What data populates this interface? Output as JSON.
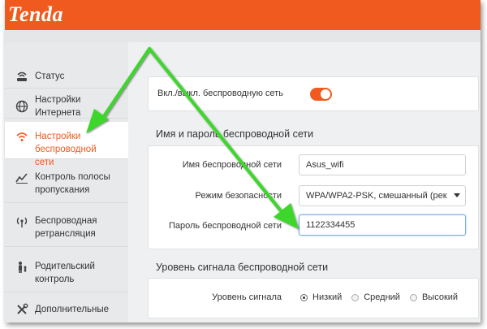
{
  "brand": {
    "logo": "Tenda",
    "accent": "#f05a1e"
  },
  "sidebar": {
    "items": [
      {
        "label": "Статус",
        "icon": "status-icon"
      },
      {
        "label": "Настройки Интернета",
        "icon": "globe-icon"
      },
      {
        "label": "Настройки беспроводной сети",
        "icon": "wifi-icon",
        "active": true
      },
      {
        "label": "Контроль полосы пропускания",
        "icon": "bandwidth-icon"
      },
      {
        "label": "Беспроводная ретрансляция",
        "icon": "repeater-icon"
      },
      {
        "label": "Родительский контроль",
        "icon": "parental-icon"
      },
      {
        "label": "Дополнительные",
        "icon": "tools-icon"
      }
    ]
  },
  "wireless_toggle": {
    "label": "Вкл./выкл. беспроводную сеть",
    "enabled": true
  },
  "ssid_section": {
    "title": "Имя и пароль беспроводной сети",
    "ssid_label": "Имя беспроводной сети",
    "ssid_value": "Asus_wifi",
    "security_label": "Режим безопасности",
    "security_value": "WPA/WPA2-PSK, смешанный (рек",
    "password_label": "Пароль беспроводной сети",
    "password_value": "1122334455"
  },
  "signal_section": {
    "title": "Уровень сигнала беспроводной сети",
    "level_label": "Уровень сигнала",
    "options": [
      "Низкий",
      "Средний",
      "Высокий"
    ],
    "selected": "Низкий"
  },
  "annotation_color": "#3cd62c"
}
